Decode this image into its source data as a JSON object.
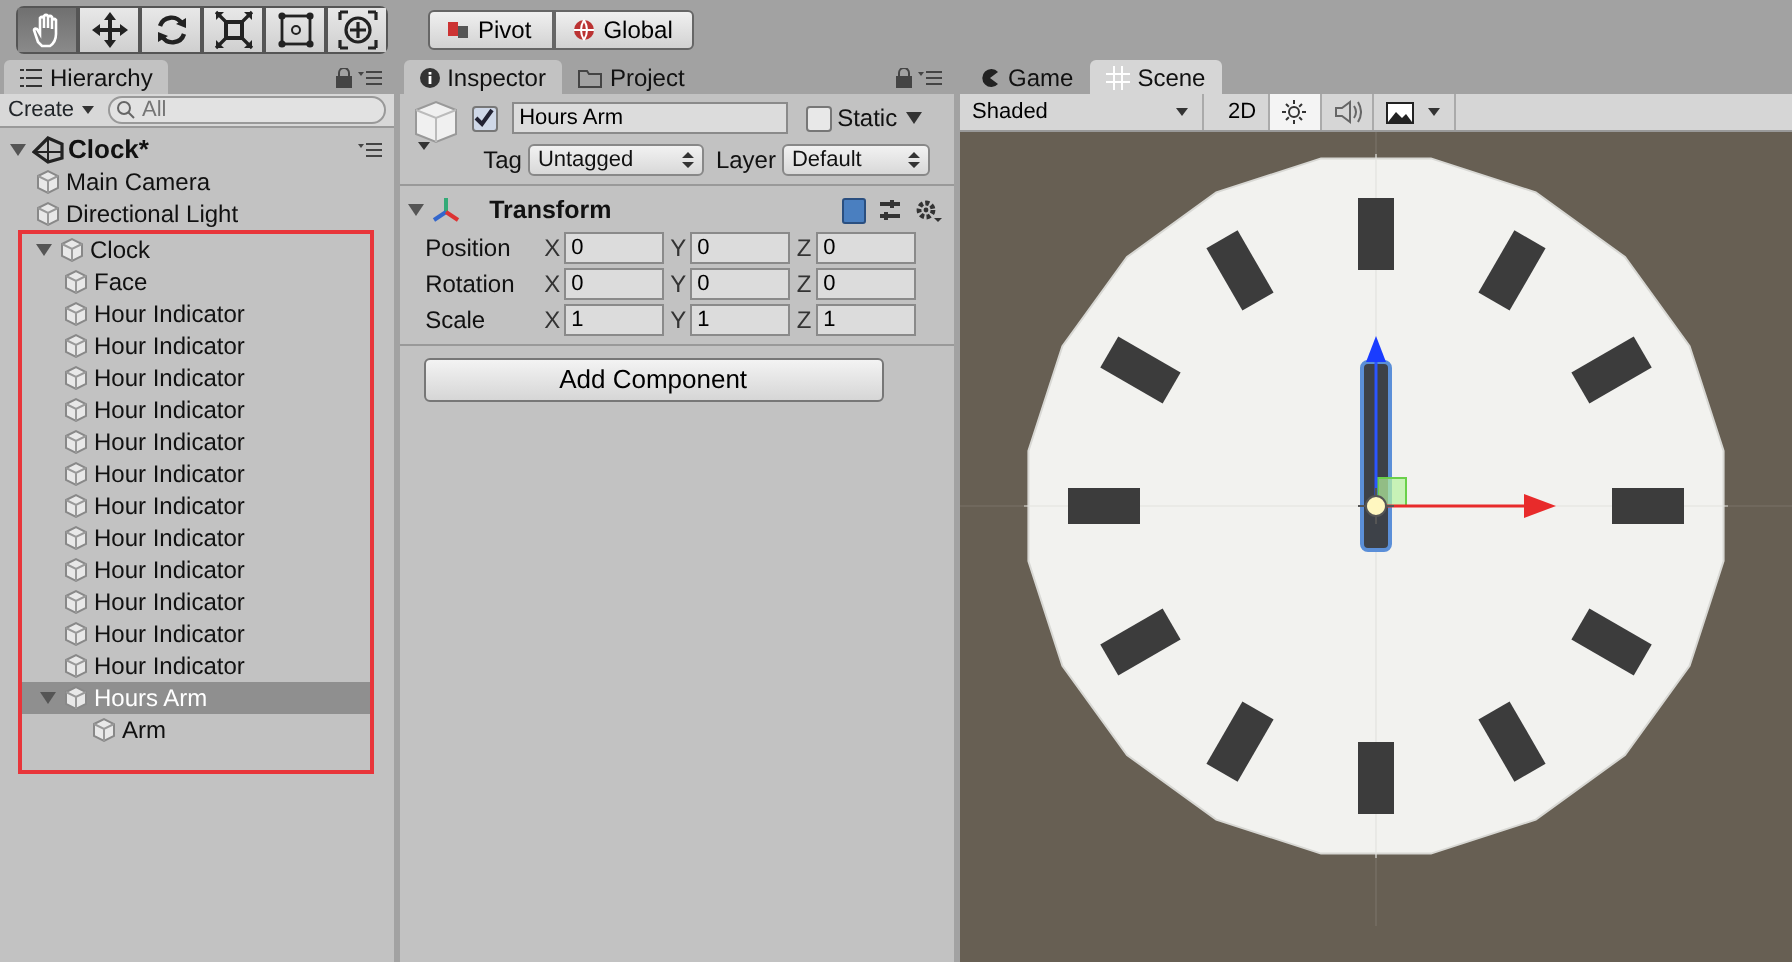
{
  "toolbar": {
    "tools": [
      {
        "selected": true
      },
      {
        "selected": false
      },
      {
        "selected": false
      },
      {
        "selected": false
      },
      {
        "selected": false
      },
      {
        "selected": false
      }
    ],
    "handles": [
      {
        "label": "Pivot"
      },
      {
        "label": "Global"
      }
    ]
  },
  "hierarchy": {
    "tab": "Hierarchy",
    "create": "Create",
    "search": {
      "placeholder": "All"
    },
    "scene": "Clock*",
    "items": [
      {
        "label": "Main Camera",
        "selected": false
      },
      {
        "label": "Directional Light",
        "selected": false
      },
      {
        "label": "Clock",
        "selected": false,
        "expanded": true,
        "highlighted": true,
        "children": [
          {
            "label": "Face",
            "selected": false
          },
          {
            "label": "Hour Indicator",
            "selected": false
          },
          {
            "label": "Hour Indicator",
            "selected": false
          },
          {
            "label": "Hour Indicator",
            "selected": false
          },
          {
            "label": "Hour Indicator",
            "selected": false
          },
          {
            "label": "Hour Indicator",
            "selected": false
          },
          {
            "label": "Hour Indicator",
            "selected": false
          },
          {
            "label": "Hour Indicator",
            "selected": false
          },
          {
            "label": "Hour Indicator",
            "selected": false
          },
          {
            "label": "Hour Indicator",
            "selected": false
          },
          {
            "label": "Hour Indicator",
            "selected": false
          },
          {
            "label": "Hour Indicator",
            "selected": false
          },
          {
            "label": "Hour Indicator",
            "selected": false
          },
          {
            "label": "Hours Arm",
            "selected": true,
            "expanded": true,
            "children": [
              {
                "label": "Arm",
                "selected": false
              }
            ]
          }
        ]
      }
    ]
  },
  "inspector": {
    "tabs": [
      {
        "label": "Inspector",
        "selected": true
      },
      {
        "label": "Project",
        "selected": false
      }
    ],
    "object": {
      "active": true,
      "name": "Hours Arm",
      "static_label": "Static",
      "static": false,
      "tag_label": "Tag",
      "tag": "Untagged",
      "layer_label": "Layer",
      "layer": "Default"
    },
    "component": {
      "title": "Transform",
      "expanded": true,
      "rows": [
        {
          "label": "Position",
          "fields": [
            {
              "axis": "X",
              "value": "0"
            },
            {
              "axis": "Y",
              "value": "0"
            },
            {
              "axis": "Z",
              "value": "0"
            }
          ]
        },
        {
          "label": "Rotation",
          "fields": [
            {
              "axis": "X",
              "value": "0"
            },
            {
              "axis": "Y",
              "value": "0"
            },
            {
              "axis": "Z",
              "value": "0"
            }
          ]
        },
        {
          "label": "Scale",
          "fields": [
            {
              "axis": "X",
              "value": "1"
            },
            {
              "axis": "Y",
              "value": "1"
            },
            {
              "axis": "Z",
              "value": "1"
            }
          ]
        }
      ]
    },
    "add_button": "Add Component"
  },
  "scene": {
    "tabs": [
      {
        "label": "Game",
        "selected": false
      },
      {
        "label": "Scene",
        "selected": true
      }
    ],
    "shading": "Shaded",
    "mode_2d": "2D",
    "mode_2d_on": false,
    "lighting_on": true,
    "audio_on": false
  }
}
